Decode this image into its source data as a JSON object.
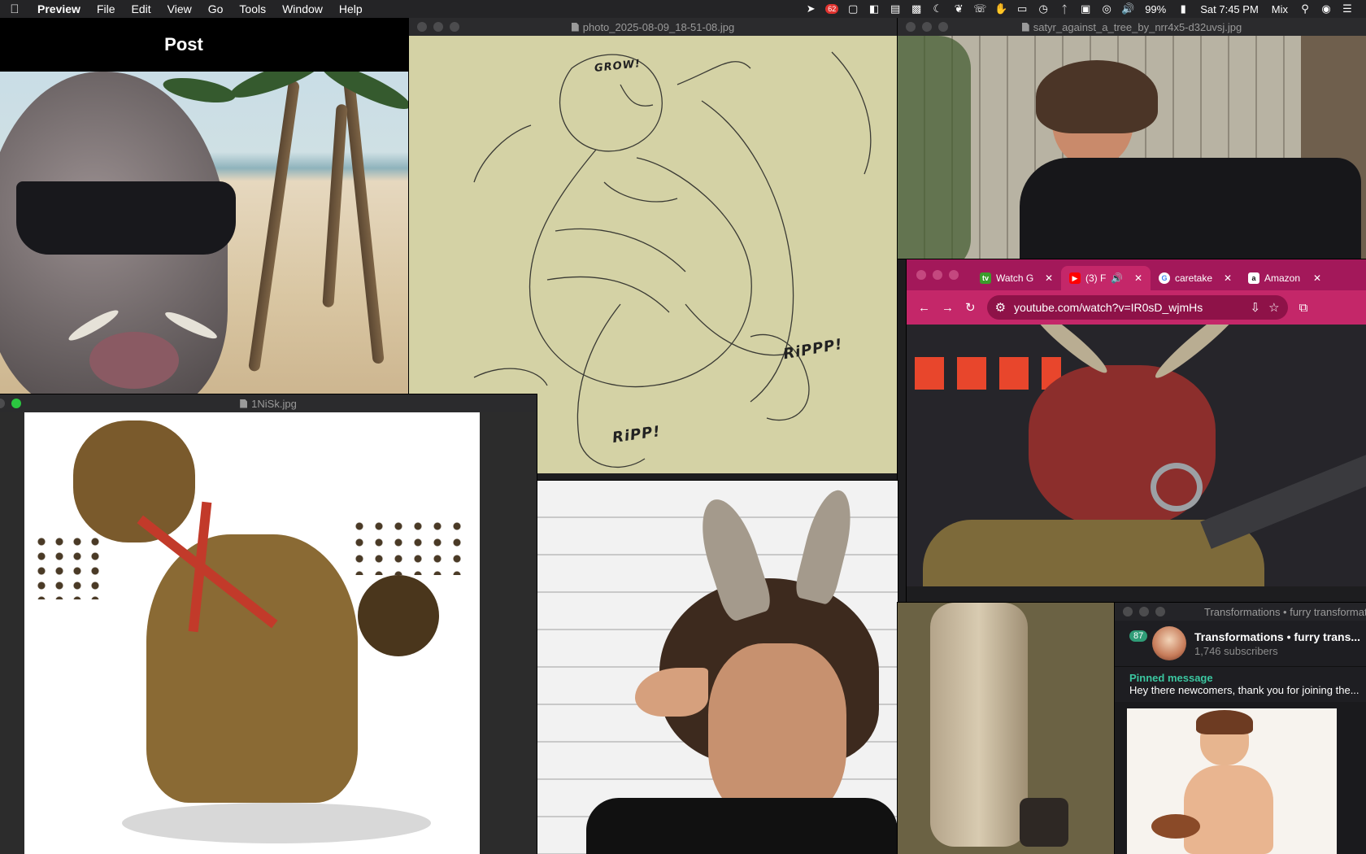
{
  "menubar": {
    "app_name": "Preview",
    "menus": [
      "File",
      "Edit",
      "View",
      "Go",
      "Tools",
      "Window",
      "Help"
    ],
    "notification_badge": "62",
    "battery": "99%",
    "datetime": "Sat 7:45 PM",
    "user": "Mix"
  },
  "post_window": {
    "header": "Post"
  },
  "sketch_window": {
    "title": "photo_2025-08-09_18-51-08.jpg",
    "sfx_grow": "GROW!",
    "sfx_rippp": "RiPPP!",
    "sfx_ripp": "RiPP!"
  },
  "satyr_window": {
    "title": "satyr_against_a_tree_by_nrr4x5-d32uvsj.jpg"
  },
  "hyena_window": {
    "title": "1NiSk.jpg"
  },
  "chrome": {
    "tabs": [
      {
        "label": "Watch G",
        "favicon": "tv-icon"
      },
      {
        "label": "(3) F",
        "favicon": "youtube-icon"
      },
      {
        "label": "caretake",
        "favicon": "google-icon"
      },
      {
        "label": "Amazon",
        "favicon": "amazon-icon"
      }
    ],
    "url": "youtube.com/watch?v=IR0sD_wjmHs"
  },
  "telegram": {
    "window_title": "Transformations • furry transformation",
    "unread": "87",
    "channel_name": "Transformations • furry trans...",
    "subscribers": "1,746 subscribers",
    "pinned_label": "Pinned message",
    "pinned_text": "Hey there newcomers, thank you for joining the..."
  },
  "colors": {
    "chrome_accent": "#c42769",
    "telegram_accent": "#3bc6a0",
    "sketch_paper": "#d4d2a5"
  }
}
